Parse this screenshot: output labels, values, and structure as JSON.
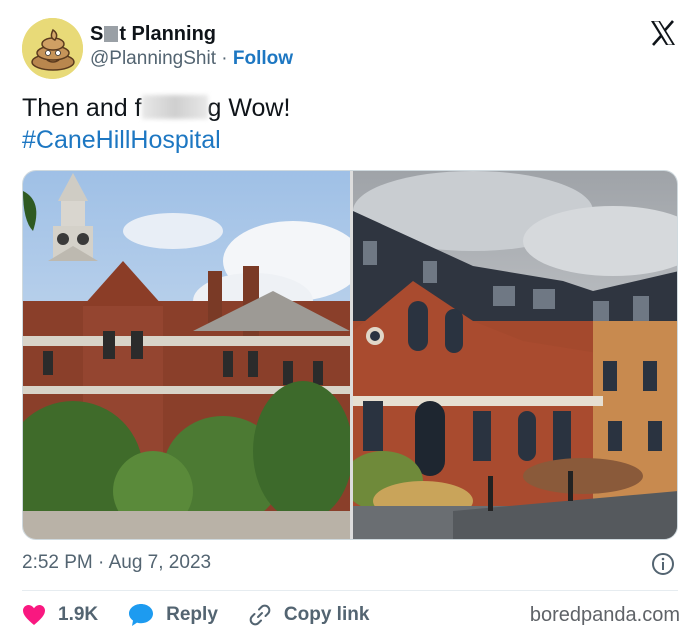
{
  "author": {
    "name_prefix": "S",
    "name_suffix": "t Planning",
    "handle": "@PlanningShit",
    "separator": "·",
    "follow_label": "Follow"
  },
  "tweet": {
    "text_before": "Then and f",
    "text_after": "g Wow!",
    "hashtag": "#CaneHillHospital"
  },
  "meta": {
    "timestamp": "2:52 PM · Aug 7, 2023"
  },
  "actions": {
    "like_count": "1.9K",
    "reply_label": "Reply",
    "copy_label": "Copy link"
  },
  "watermark": "boredpanda.com",
  "icons": {
    "avatar": "poop-emoji-icon",
    "brand": "x-logo-icon",
    "info": "info-icon",
    "like": "heart-icon",
    "reply": "speech-bubble-icon",
    "copy": "link-icon"
  },
  "colors": {
    "accent": "#1d77c2",
    "like": "#f91880",
    "muted": "#536471"
  }
}
